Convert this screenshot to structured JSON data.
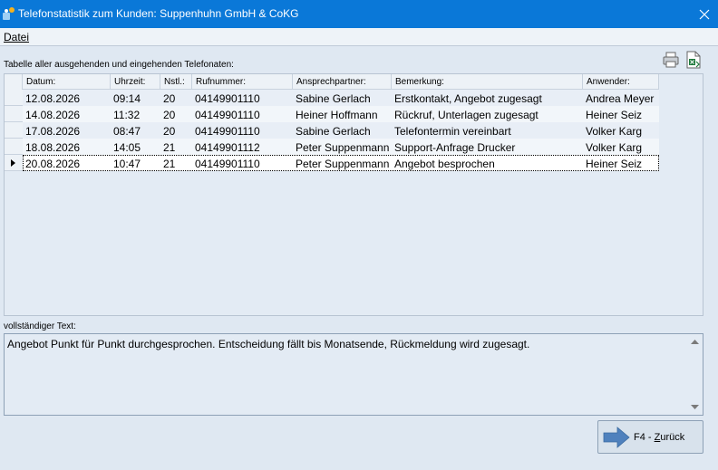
{
  "window": {
    "title": "Telefonstatistik zum Kunden: Suppenhuhn GmbH & CoKG",
    "close_icon": "close-icon",
    "app_icon": "app-icon"
  },
  "menu": {
    "items": [
      {
        "label": "Datei"
      }
    ]
  },
  "toolbar": {
    "print_icon": "printer-icon",
    "export_icon": "export-excel-icon"
  },
  "table": {
    "caption": "Tabelle aller ausgehenden und eingehenden Telefonaten:",
    "columns": [
      "Datum:",
      "Uhrzeit:",
      "Nstl.:",
      "Rufnummer:",
      "Ansprechpartner:",
      "Bemerkung:",
      "Anwender:"
    ],
    "rows": [
      [
        "12.08.2026",
        "09:14",
        "20",
        "04149901110",
        "Sabine Gerlach",
        "Erstkontakt, Angebot zugesagt",
        "Andrea Meyer"
      ],
      [
        "14.08.2026",
        "11:32",
        "20",
        "04149901110",
        "Heiner Hoffmann",
        "Rückruf, Unterlagen zugesagt",
        "Heiner Seiz"
      ],
      [
        "17.08.2026",
        "08:47",
        "20",
        "04149901110",
        "Sabine Gerlach",
        "Telefontermin vereinbart",
        "Volker Karg"
      ],
      [
        "18.08.2026",
        "14:05",
        "21",
        "04149901112",
        "Peter Suppenmann",
        "Support-Anfrage Drucker",
        "Volker Karg"
      ],
      [
        "20.08.2026",
        "10:47",
        "21",
        "04149901110",
        "Peter Suppenmann",
        "Angebot besprochen",
        "Heiner Seiz"
      ]
    ],
    "selected_row": 4
  },
  "fulltext": {
    "label": "vollständiger Text:",
    "value": "Angebot Punkt für Punkt durchgesprochen. Entscheidung fällt bis Monatsende, Rückmeldung wird zugesagt."
  },
  "back_button": {
    "label_prefix": "F4 - ",
    "label_accel": "Z",
    "label_rest": "urück"
  },
  "colors": {
    "titlebar": "#0a78d8",
    "background": "#dfe8f2",
    "arrow": "#4f81bd"
  }
}
